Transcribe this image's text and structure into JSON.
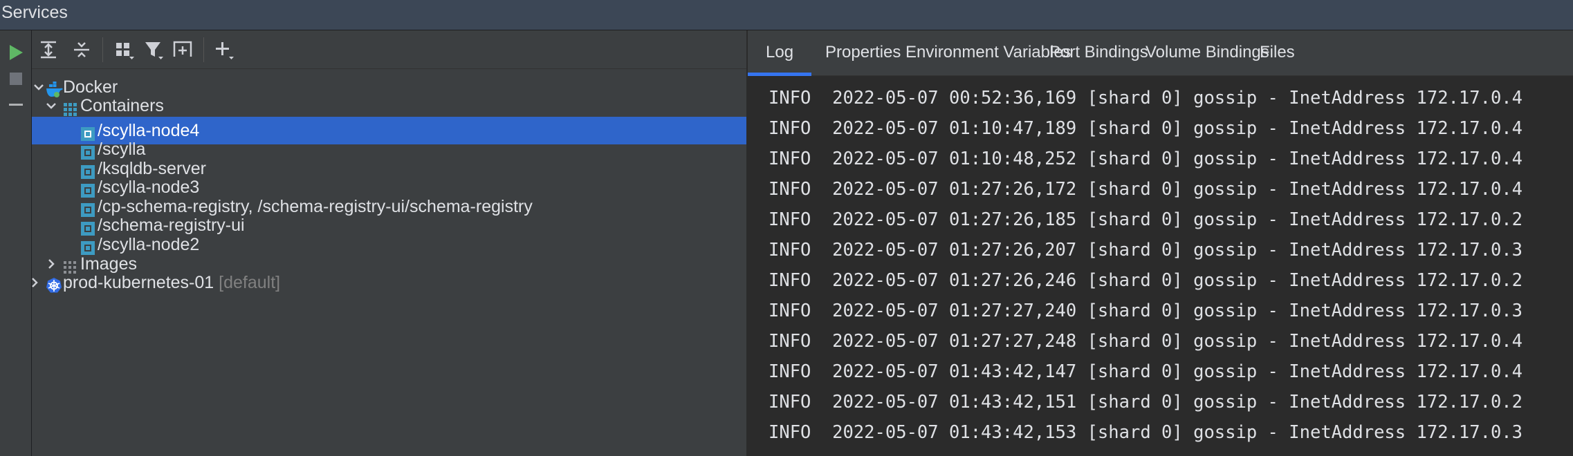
{
  "window": {
    "title": "Services"
  },
  "gutter": {
    "buttons": [
      {
        "name": "run-icon"
      },
      {
        "name": "stop-icon"
      },
      {
        "name": "minimize-icon"
      }
    ]
  },
  "toolbar": {
    "buttons": [
      {
        "name": "expand-all-icon"
      },
      {
        "name": "collapse-all-icon"
      },
      {
        "name": "group-by-icon"
      },
      {
        "name": "filter-icon"
      },
      {
        "name": "new-tab-icon"
      },
      {
        "name": "add-service-icon"
      }
    ]
  },
  "tree": {
    "docker": {
      "label": "Docker"
    },
    "containers": {
      "label": "Containers",
      "items": [
        {
          "label": "/scylla-node4",
          "selected": true
        },
        {
          "label": "/scylla"
        },
        {
          "label": "/ksqldb-server"
        },
        {
          "label": "/scylla-node3"
        },
        {
          "label": "/cp-schema-registry, /schema-registry-ui/schema-registry"
        },
        {
          "label": "/schema-registry-ui"
        },
        {
          "label": "/scylla-node2"
        }
      ]
    },
    "images": {
      "label": "Images"
    },
    "kubernetes": {
      "label": "prod-kubernetes-01",
      "hint": "[default]"
    }
  },
  "tabs": {
    "items": [
      {
        "label": "Log",
        "active": true
      },
      {
        "label": "Properties"
      },
      {
        "label": "Environment Variables"
      },
      {
        "label": "Port Bindings"
      },
      {
        "label": "Volume Bindings"
      },
      {
        "label": "Files"
      }
    ]
  },
  "log": {
    "lines": [
      "INFO  2022-05-07 00:52:36,169 [shard 0] gossip - InetAddress 172.17.0.4",
      "INFO  2022-05-07 01:10:47,189 [shard 0] gossip - InetAddress 172.17.0.4",
      "INFO  2022-05-07 01:10:48,252 [shard 0] gossip - InetAddress 172.17.0.4",
      "INFO  2022-05-07 01:27:26,172 [shard 0] gossip - InetAddress 172.17.0.4",
      "INFO  2022-05-07 01:27:26,185 [shard 0] gossip - InetAddress 172.17.0.2",
      "INFO  2022-05-07 01:27:26,207 [shard 0] gossip - InetAddress 172.17.0.3",
      "INFO  2022-05-07 01:27:26,246 [shard 0] gossip - InetAddress 172.17.0.2",
      "INFO  2022-05-07 01:27:27,240 [shard 0] gossip - InetAddress 172.17.0.3",
      "INFO  2022-05-07 01:27:27,248 [shard 0] gossip - InetAddress 172.17.0.4",
      "INFO  2022-05-07 01:43:42,147 [shard 0] gossip - InetAddress 172.17.0.4",
      "INFO  2022-05-07 01:43:42,151 [shard 0] gossip - InetAddress 172.17.0.2",
      "INFO  2022-05-07 01:43:42,153 [shard 0] gossip - InetAddress 172.17.0.3"
    ]
  },
  "colors": {
    "accent": "#3574F0",
    "selection": "#2F65CA",
    "run_green": "#5FB865",
    "container_icon": "#3D9BC2",
    "docker_blue": "#2496ED",
    "kubernetes_blue": "#326CE5"
  }
}
